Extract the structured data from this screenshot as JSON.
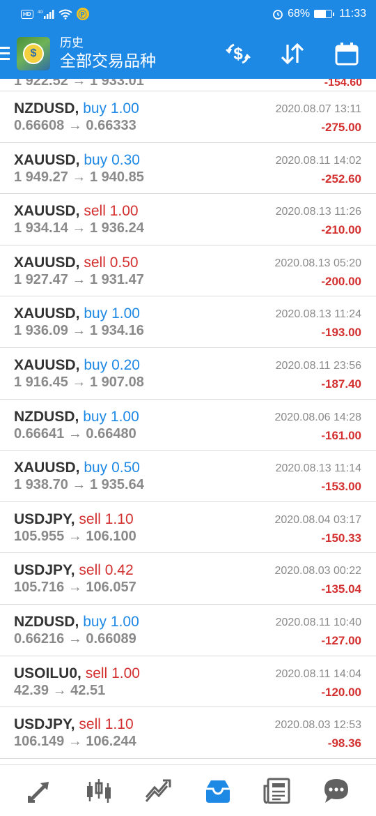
{
  "status_bar": {
    "network": "4G",
    "battery": "68%",
    "time": "11:33",
    "hd": "HD",
    "app_badge": "Ⓟ"
  },
  "app_bar": {
    "subtitle": "历史",
    "title": "全部交易品种",
    "logo_glyph": "$",
    "accent": "#1e88e5"
  },
  "partial_row": {
    "prices": "1 922.52 → 1 933.01",
    "profit": "-154.60"
  },
  "trades": [
    {
      "symbol": "NZDUSD,",
      "side": "buy",
      "volume": "1.00",
      "time": "2020.08.07 13:11",
      "prices": "0.66608 → 0.66333",
      "profit": "-275.00"
    },
    {
      "symbol": "XAUUSD,",
      "side": "buy",
      "volume": "0.30",
      "time": "2020.08.11 14:02",
      "prices": "1 949.27 → 1 940.85",
      "profit": "-252.60"
    },
    {
      "symbol": "XAUUSD,",
      "side": "sell",
      "volume": "1.00",
      "time": "2020.08.13 11:26",
      "prices": "1 934.14 → 1 936.24",
      "profit": "-210.00"
    },
    {
      "symbol": "XAUUSD,",
      "side": "sell",
      "volume": "0.50",
      "time": "2020.08.13 05:20",
      "prices": "1 927.47 → 1 931.47",
      "profit": "-200.00"
    },
    {
      "symbol": "XAUUSD,",
      "side": "buy",
      "volume": "1.00",
      "time": "2020.08.13 11:24",
      "prices": "1 936.09 → 1 934.16",
      "profit": "-193.00"
    },
    {
      "symbol": "XAUUSD,",
      "side": "buy",
      "volume": "0.20",
      "time": "2020.08.11 23:56",
      "prices": "1 916.45 → 1 907.08",
      "profit": "-187.40"
    },
    {
      "symbol": "NZDUSD,",
      "side": "buy",
      "volume": "1.00",
      "time": "2020.08.06 14:28",
      "prices": "0.66641 → 0.66480",
      "profit": "-161.00"
    },
    {
      "symbol": "XAUUSD,",
      "side": "buy",
      "volume": "0.50",
      "time": "2020.08.13 11:14",
      "prices": "1 938.70 → 1 935.64",
      "profit": "-153.00"
    },
    {
      "symbol": "USDJPY,",
      "side": "sell",
      "volume": "1.10",
      "time": "2020.08.04 03:17",
      "prices": "105.955 → 106.100",
      "profit": "-150.33"
    },
    {
      "symbol": "USDJPY,",
      "side": "sell",
      "volume": "0.42",
      "time": "2020.08.03 00:22",
      "prices": "105.716 → 106.057",
      "profit": "-135.04"
    },
    {
      "symbol": "NZDUSD,",
      "side": "buy",
      "volume": "1.00",
      "time": "2020.08.11 10:40",
      "prices": "0.66216 → 0.66089",
      "profit": "-127.00"
    },
    {
      "symbol": "USOILU0,",
      "side": "sell",
      "volume": "1.00",
      "time": "2020.08.11 14:04",
      "prices": "42.39 → 42.51",
      "profit": "-120.00"
    },
    {
      "symbol": "USDJPY,",
      "side": "sell",
      "volume": "1.10",
      "time": "2020.08.03 12:53",
      "prices": "106.149 → 106.244",
      "profit": "-98.36"
    }
  ],
  "bottom_nav": [
    {
      "name": "quotes-icon"
    },
    {
      "name": "chart-icon"
    },
    {
      "name": "trade-icon"
    },
    {
      "name": "history-icon",
      "active": true
    },
    {
      "name": "news-icon"
    },
    {
      "name": "messages-icon"
    }
  ],
  "colors": {
    "buy": "#1e88e5",
    "sell": "#d32f2f",
    "loss": "#d32f2f",
    "nav_inactive": "#616161",
    "nav_active": "#1e88e5"
  }
}
